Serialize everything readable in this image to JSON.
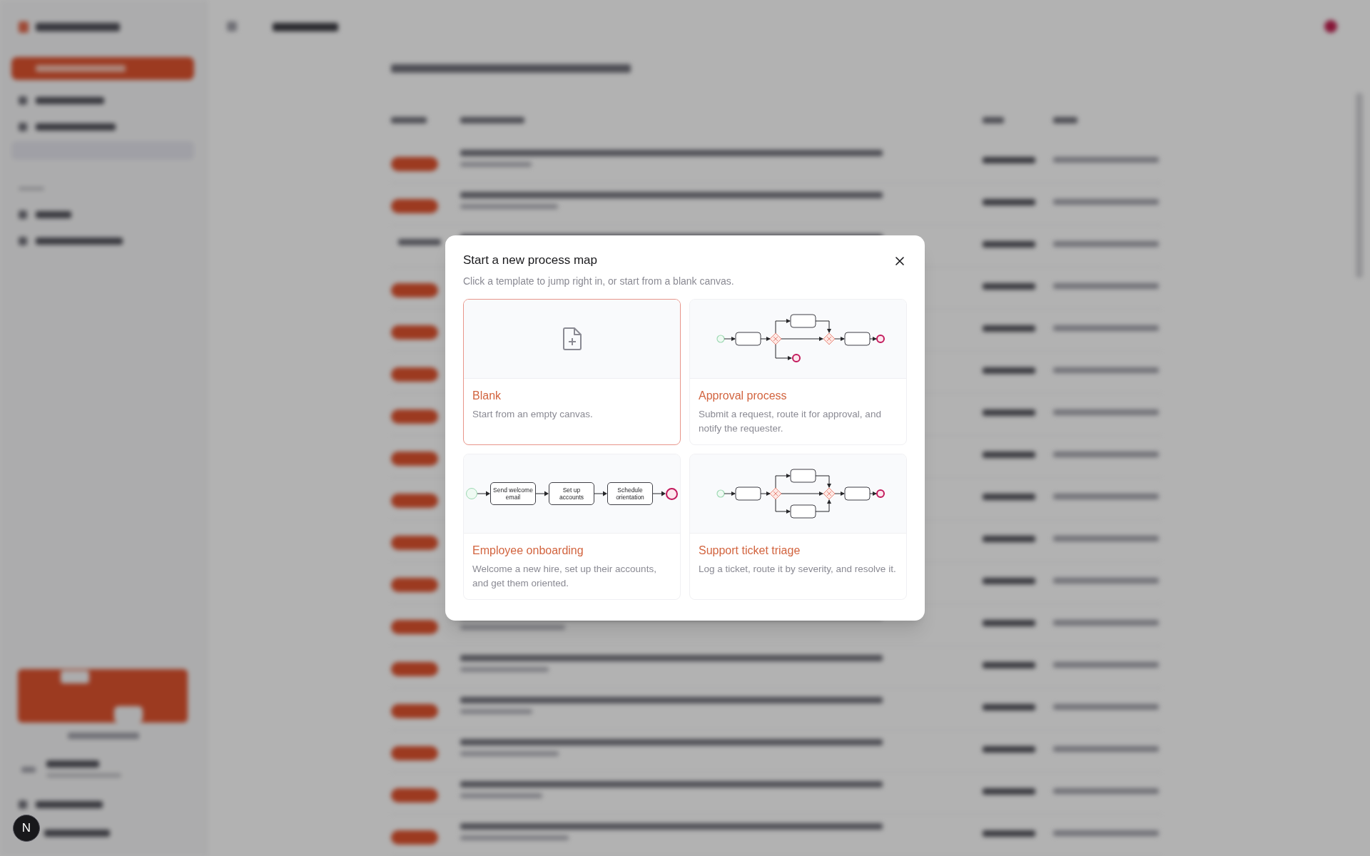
{
  "background": {
    "kind": "blurred-page"
  },
  "modal": {
    "title": "Start a new process map",
    "subtitle": "Click a template to jump right in, or start from a blank canvas.",
    "templates": [
      {
        "title": "Blank",
        "description": "Start from an empty canvas.",
        "selected": true,
        "preview": {
          "kind": "blank"
        }
      },
      {
        "title": "Approval process",
        "description": "Submit a request, route it for approval, and notify the requester.",
        "selected": false,
        "preview": {
          "kind": "approval"
        }
      },
      {
        "title": "Employee onboarding",
        "description": "Welcome a new hire, set up their accounts, and get them oriented.",
        "selected": false,
        "preview": {
          "kind": "linear",
          "steps": [
            "Send welcome email",
            "Set up accounts",
            "Schedule orientation"
          ]
        }
      },
      {
        "title": "Support ticket triage",
        "description": "Log a ticket, route it by severity, and resolve it.",
        "selected": false,
        "preview": {
          "kind": "triage"
        }
      }
    ]
  },
  "dev_badge": {
    "label": "N"
  }
}
